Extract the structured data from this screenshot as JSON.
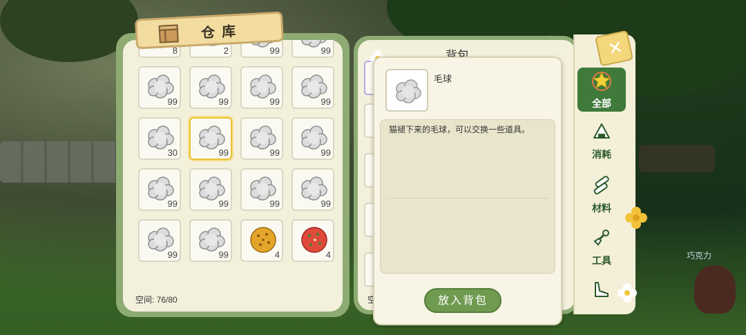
{
  "warehouse": {
    "title": "仓库",
    "capacity_text": "空间: 76/80",
    "items": [
      {
        "kind": "red-ball",
        "count": "8"
      },
      {
        "kind": "silver",
        "count": "2"
      },
      {
        "kind": "fur-ball",
        "count": "99"
      },
      {
        "kind": "fur-ball",
        "count": "99"
      },
      {
        "kind": "fur-ball",
        "count": "99"
      },
      {
        "kind": "fur-ball",
        "count": "99"
      },
      {
        "kind": "fur-ball",
        "count": "99"
      },
      {
        "kind": "fur-ball",
        "count": "99"
      },
      {
        "kind": "fur-ball",
        "count": "30"
      },
      {
        "kind": "fur-ball",
        "count": "99"
      },
      {
        "kind": "fur-ball",
        "count": "99"
      },
      {
        "kind": "fur-ball",
        "count": "99"
      },
      {
        "kind": "fur-ball",
        "count": "99"
      },
      {
        "kind": "fur-ball",
        "count": "99"
      },
      {
        "kind": "fur-ball",
        "count": "99"
      },
      {
        "kind": "fur-ball",
        "count": "99"
      },
      {
        "kind": "fur-ball",
        "count": "99"
      },
      {
        "kind": "fur-ball",
        "count": "99"
      },
      {
        "kind": "orange-cookie",
        "count": "4"
      },
      {
        "kind": "red-cookie",
        "count": "4"
      }
    ],
    "selected_index": 9
  },
  "backpack": {
    "title": "背包",
    "capacity_prefix": "空"
  },
  "detail": {
    "name": "毛球",
    "description": "猫褪下来的毛球，可以交换一些道具。",
    "button_label": "放入背包"
  },
  "categories": [
    {
      "label": "全部",
      "icon": "star-icon",
      "active": true
    },
    {
      "label": "消耗",
      "icon": "rice-ball-icon",
      "active": false
    },
    {
      "label": "材料",
      "icon": "wood-icon",
      "active": false
    },
    {
      "label": "工具",
      "icon": "shovel-icon",
      "active": false
    },
    {
      "label": "",
      "icon": "shoe-icon",
      "active": false
    }
  ],
  "npc_name": "巧克力",
  "colors": {
    "panel_green": "#8dab72",
    "cream": "#f3f0dc",
    "active_green": "#3f7a3a",
    "button_green": "#6f9a50",
    "selected_gold": "#e8c23a"
  }
}
